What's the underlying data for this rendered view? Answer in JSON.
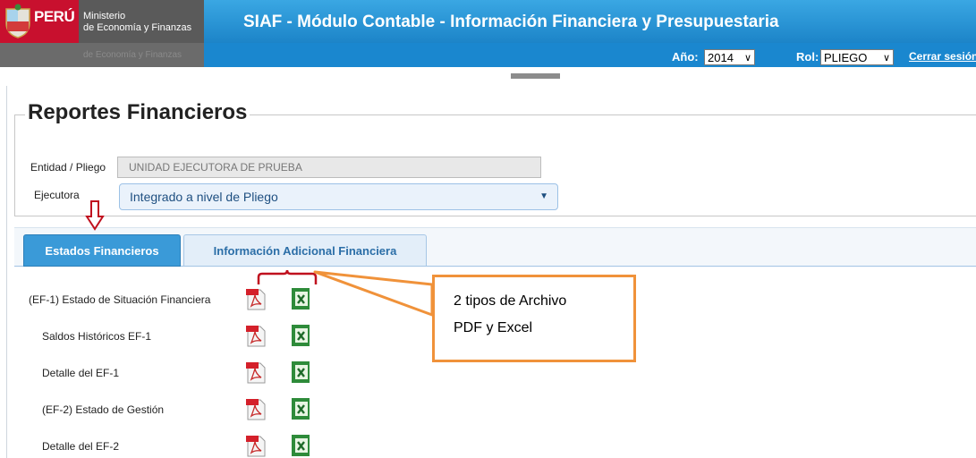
{
  "header": {
    "logo": {
      "country": "PERÚ",
      "ministry_line1": "Ministerio",
      "ministry_line2": "de Economía y Finanzas"
    },
    "app_title": "SIAF - Módulo Contable - Información Financiera y Presupuestaria",
    "year": {
      "label": "Año:",
      "value": "2014"
    },
    "role": {
      "label": "Rol:",
      "value": "PLIEGO"
    },
    "logout_label": "Cerrar sesión"
  },
  "page": {
    "title": "Reportes Financieros",
    "entity": {
      "label": "Entidad / Pliego",
      "value": "UNIDAD EJECUTORA DE PRUEBA"
    },
    "executor": {
      "label": "Ejecutora",
      "value": "Integrado a nivel de Pliego"
    }
  },
  "tabs": [
    {
      "label": "Estados Financieros"
    },
    {
      "label": "Información Adicional Financiera"
    }
  ],
  "reports": [
    {
      "label": "(EF-1) Estado de Situación Financiera"
    },
    {
      "label": "Saldos Históricos EF-1"
    },
    {
      "label": "Detalle del EF-1"
    },
    {
      "label": "(EF-2) Estado de Gestión"
    },
    {
      "label": "Detalle del EF-2"
    }
  ],
  "callout": {
    "line1": "2 tipos de Archivo",
    "line2": "PDF y Excel"
  },
  "colors": {
    "header_blue": "#1a87cf",
    "tab_active": "#3a9ad8",
    "annotation_orange": "#f0923a",
    "annotation_red": "#c0111f"
  }
}
